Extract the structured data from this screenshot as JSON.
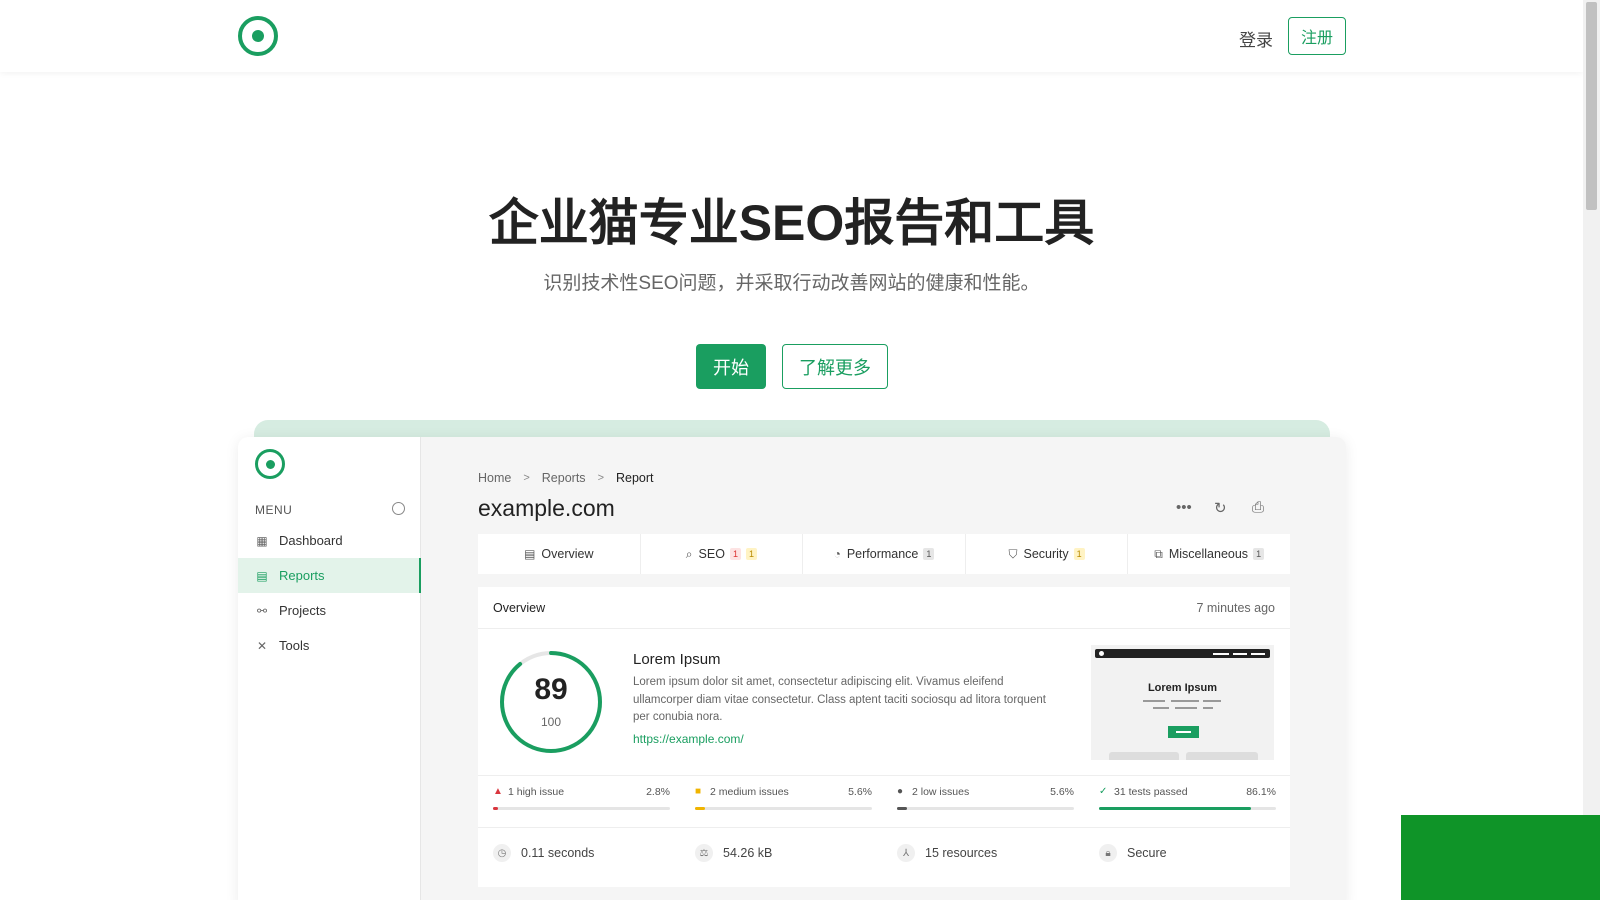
{
  "nav": {
    "login": "登录",
    "signup": "注册"
  },
  "hero": {
    "title": "企业猫专业SEO报告和工具",
    "subtitle": "识别技术性SEO问题，并采取行动改善网站的健康和性能。",
    "start_button": "开始",
    "learn_more_button": "了解更多"
  },
  "app": {
    "menu_label": "MENU",
    "sidebar": {
      "items": [
        {
          "label": "Dashboard",
          "icon": "dashboard-icon",
          "active": false
        },
        {
          "label": "Reports",
          "icon": "reports-icon",
          "active": true
        },
        {
          "label": "Projects",
          "icon": "projects-icon",
          "active": false
        },
        {
          "label": "Tools",
          "icon": "tools-icon",
          "active": false
        }
      ]
    },
    "breadcrumb": [
      "Home",
      "Reports",
      "Report"
    ],
    "site_title": "example.com",
    "tabs": [
      {
        "label": "Overview",
        "icon": "overview-icon",
        "badges": []
      },
      {
        "label": "SEO",
        "icon": "search-icon",
        "badges": [
          {
            "v": "1",
            "c": "red"
          },
          {
            "v": "1",
            "c": "yellow"
          }
        ]
      },
      {
        "label": "Performance",
        "icon": "gauge-icon",
        "badges": [
          {
            "v": "1",
            "c": "gray"
          }
        ]
      },
      {
        "label": "Security",
        "icon": "shield-icon",
        "badges": [
          {
            "v": "1",
            "c": "yellow"
          }
        ]
      },
      {
        "label": "Miscellaneous",
        "icon": "shapes-icon",
        "badges": [
          {
            "v": "1",
            "c": "gray"
          }
        ]
      }
    ],
    "overview": {
      "title": "Overview",
      "time_ago": "7 minutes ago",
      "score": "89",
      "score_max": "100",
      "score_fraction": 0.89,
      "page_title": "Lorem Ipsum",
      "description": "Lorem ipsum dolor sit amet, consectetur adipiscing elit. Vivamus eleifend ullamcorper diam vitae consectetur. Class aptent taciti sociosqu ad litora torquent per conubia nora.",
      "url": "https://example.com/",
      "thumbnail_title": "Lorem Ipsum"
    },
    "issues": [
      {
        "label": "1 high issue",
        "pct": "2.8%",
        "fraction": 0.028,
        "color": "#d9363e",
        "symbol": "▲"
      },
      {
        "label": "2 medium issues",
        "pct": "5.6%",
        "fraction": 0.056,
        "color": "#f0b400",
        "symbol": "■"
      },
      {
        "label": "2 low issues",
        "pct": "5.6%",
        "fraction": 0.056,
        "color": "#555555",
        "symbol": "●"
      },
      {
        "label": "31 tests passed",
        "pct": "86.1%",
        "fraction": 0.861,
        "color": "#1a9e60",
        "symbol": "✓"
      }
    ],
    "stats": [
      {
        "label": "0.11 seconds",
        "icon": "timer-icon"
      },
      {
        "label": "54.26 kB",
        "icon": "scale-icon"
      },
      {
        "label": "15 resources",
        "icon": "resources-icon"
      },
      {
        "label": "Secure",
        "icon": "lock-icon"
      }
    ]
  },
  "colors": {
    "accent": "#1a9e60",
    "green_block": "#0f9428"
  }
}
